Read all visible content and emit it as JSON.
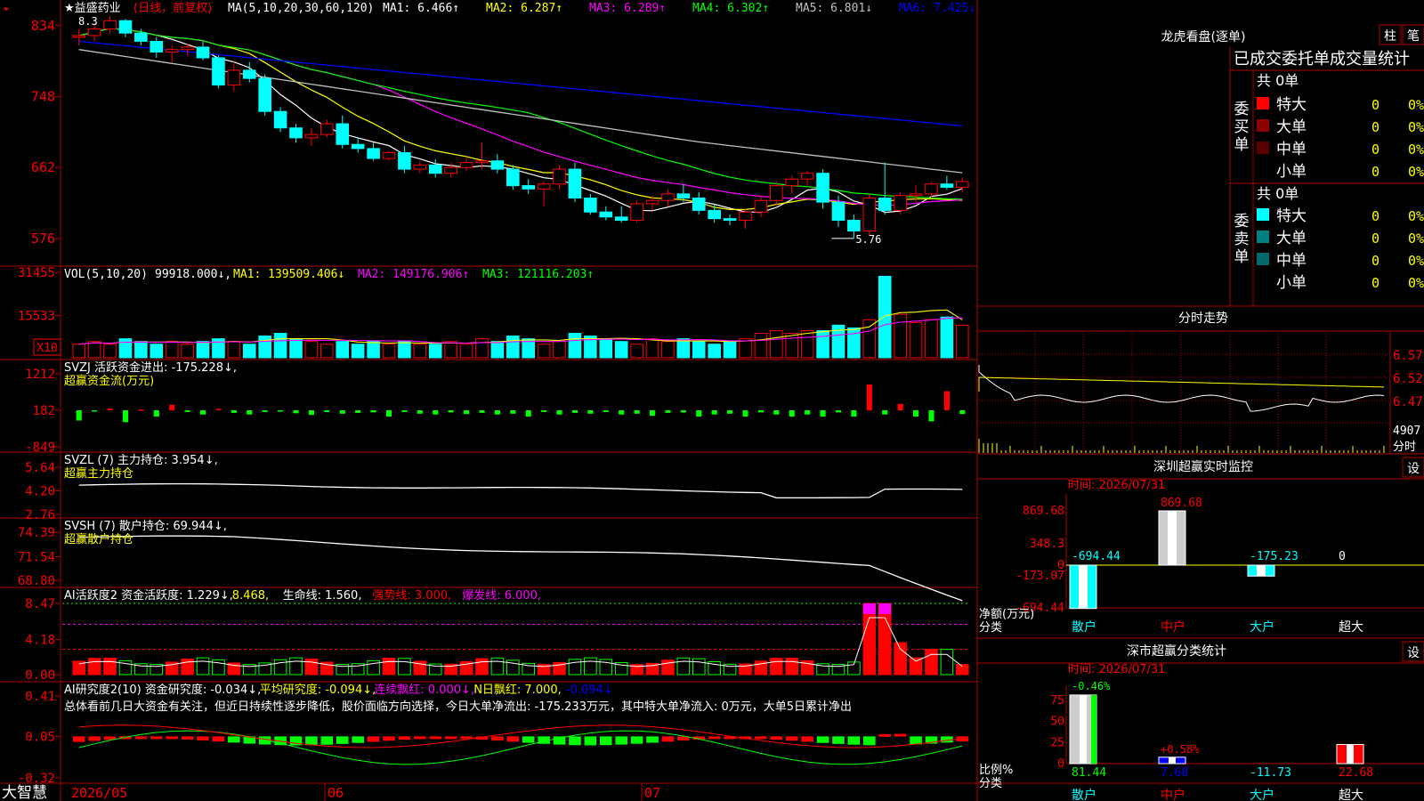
{
  "app": {
    "brand": "大智慧",
    "stock_title": "★益盛药业",
    "period": "(日线，前复权)",
    "ma_prefix": "MA(5,10,20,30,60,120)",
    "ma_values": [
      {
        "label": "MA1: 6.466↑",
        "color": "#ffffff"
      },
      {
        "label": "MA2: 6.287↑",
        "color": "#ffff00"
      },
      {
        "label": "MA3: 6.289↑",
        "color": "#ff00ff"
      },
      {
        "label": "MA4: 6.302↑",
        "color": "#00ff00"
      },
      {
        "label": "MA5: 6.801↓",
        "color": "#c0c0c0"
      },
      {
        "label": "MA6: 7.425↓",
        "color": "#0000ff"
      }
    ],
    "annot_low": "5.76",
    "annot_high": "8.3"
  },
  "colors": {
    "up": "#ff0000",
    "down": "#00ffff",
    "grid": "#b00000",
    "bg": "#000000"
  },
  "axes": {
    "price_ticks": [
      "834",
      "748",
      "662",
      "576"
    ],
    "vol_ticks": [
      "31455",
      "15533"
    ],
    "vol_unit": "X10",
    "svzj_ticks": [
      "1212",
      "182",
      "-849"
    ],
    "svzl_ticks": [
      "5.64",
      "4.20",
      "2.76"
    ],
    "svsh_ticks": [
      "74.39",
      "71.54",
      "68.80"
    ],
    "ai_ticks": [
      "8.47",
      "4.18",
      "0.00"
    ],
    "ai2_ticks": [
      "0.41",
      "0.05",
      "-0.32"
    ],
    "dates": [
      "2026/05",
      "06",
      "07"
    ]
  },
  "chart_data": [
    {
      "type": "candlestick",
      "title": "益盛药业 (日线，前复权)",
      "ylim": [
        5.5,
        8.5
      ],
      "ohlc": [
        [
          8.2,
          8.3,
          8.1,
          8.22
        ],
        [
          8.22,
          8.35,
          8.15,
          8.3
        ],
        [
          8.3,
          8.45,
          8.25,
          8.4
        ],
        [
          8.4,
          8.42,
          8.2,
          8.25
        ],
        [
          8.25,
          8.3,
          8.1,
          8.15
        ],
        [
          8.15,
          8.2,
          7.95,
          8.02
        ],
        [
          8.02,
          8.1,
          7.9,
          8.05
        ],
        [
          8.05,
          8.12,
          7.98,
          8.08
        ],
        [
          8.08,
          8.15,
          7.92,
          7.95
        ],
        [
          7.95,
          7.98,
          7.58,
          7.62
        ],
        [
          7.62,
          7.9,
          7.55,
          7.8
        ],
        [
          7.8,
          7.9,
          7.65,
          7.7
        ],
        [
          7.7,
          7.75,
          7.25,
          7.3
        ],
        [
          7.3,
          7.35,
          7.05,
          7.1
        ],
        [
          7.1,
          7.15,
          6.92,
          6.98
        ],
        [
          6.98,
          7.1,
          6.88,
          7.02
        ],
        [
          7.02,
          7.2,
          6.98,
          7.15
        ],
        [
          7.15,
          7.25,
          6.85,
          6.9
        ],
        [
          6.9,
          6.98,
          6.8,
          6.85
        ],
        [
          6.85,
          6.92,
          6.7,
          6.73
        ],
        [
          6.73,
          6.82,
          6.7,
          6.8
        ],
        [
          6.8,
          6.88,
          6.55,
          6.6
        ],
        [
          6.6,
          6.7,
          6.55,
          6.65
        ],
        [
          6.65,
          6.72,
          6.5,
          6.55
        ],
        [
          6.55,
          6.68,
          6.5,
          6.62
        ],
        [
          6.62,
          6.75,
          6.58,
          6.68
        ],
        [
          6.68,
          6.92,
          6.6,
          6.7
        ],
        [
          6.7,
          6.78,
          6.55,
          6.6
        ],
        [
          6.6,
          6.65,
          6.35,
          6.4
        ],
        [
          6.4,
          6.48,
          6.3,
          6.36
        ],
        [
          6.36,
          6.45,
          6.15,
          6.42
        ],
        [
          6.42,
          6.65,
          6.35,
          6.6
        ],
        [
          6.6,
          6.68,
          6.2,
          6.25
        ],
        [
          6.25,
          6.3,
          6.05,
          6.08
        ],
        [
          6.08,
          6.15,
          5.98,
          6.02
        ],
        [
          6.02,
          6.15,
          5.95,
          5.98
        ],
        [
          5.98,
          6.22,
          5.95,
          6.18
        ],
        [
          6.18,
          6.28,
          6.1,
          6.22
        ],
        [
          6.22,
          6.35,
          6.15,
          6.3
        ],
        [
          6.3,
          6.42,
          6.2,
          6.25
        ],
        [
          6.25,
          6.32,
          6.05,
          6.1
        ],
        [
          6.1,
          6.18,
          5.95,
          6.0
        ],
        [
          6.0,
          6.05,
          5.92,
          5.98
        ],
        [
          5.98,
          6.12,
          5.88,
          6.08
        ],
        [
          6.08,
          6.28,
          6.02,
          6.22
        ],
        [
          6.22,
          6.45,
          6.15,
          6.4
        ],
        [
          6.4,
          6.52,
          6.3,
          6.48
        ],
        [
          6.48,
          6.58,
          6.4,
          6.55
        ],
        [
          6.55,
          6.6,
          6.12,
          6.2
        ],
        [
          6.2,
          6.28,
          5.9,
          5.98
        ],
        [
          5.98,
          6.05,
          5.76,
          5.85
        ],
        [
          5.85,
          6.3,
          5.8,
          6.25
        ],
        [
          6.25,
          6.68,
          6.05,
          6.1
        ],
        [
          6.1,
          6.32,
          6.05,
          6.28
        ],
        [
          6.28,
          6.4,
          6.2,
          6.3
        ],
        [
          6.3,
          6.45,
          6.25,
          6.42
        ],
        [
          6.42,
          6.52,
          6.35,
          6.38
        ],
        [
          6.38,
          6.5,
          6.32,
          6.45
        ]
      ]
    },
    {
      "type": "bar",
      "name": "VOL(5,10,20)",
      "summary": "99918.000",
      "ma": [
        "MA1: 139509.406↓",
        "MA2: 149176.906↑",
        "MA3: 121116.203↑"
      ]
    },
    {
      "type": "bar",
      "name": "SVZJ 活跃资金进出",
      "value_text": "SVZJ  活跃资金进出: -175.228↓,",
      "sub": "超赢资金流(万元)"
    },
    {
      "type": "line",
      "name": "SVZL (7) 主力持仓",
      "value_text": "SVZL (7) 主力持仓: 3.954↓,",
      "sub": "超赢主力持仓"
    },
    {
      "type": "line",
      "name": "SVSH (7) 散户持仓",
      "value_text": "SVSH (7) 散户持仓: 69.944↓,",
      "sub": "超赢散户持仓"
    },
    {
      "type": "bar",
      "name": "AI活跃度2",
      "value_parts": [
        {
          "t": "AI活跃度2 资金活跃度: 1.229↓,",
          "c": "#ffffff"
        },
        {
          "t": "8.468,",
          "c": "#ffff00"
        },
        {
          "t": "生命线: 1.560,",
          "c": "#ffffff"
        },
        {
          "t": "强势线: 3.000,",
          "c": "#ff0000"
        },
        {
          "t": "爆发线: 6.000,",
          "c": "#ff00ff"
        }
      ]
    },
    {
      "type": "bar",
      "name": "AI研究度2(10)",
      "value_parts": [
        {
          "t": "AI研究度2(10) 资金研究度: -0.034↓,",
          "c": "#ffffff"
        },
        {
          "t": "平均研究度: -0.094↓,",
          "c": "#ffff00"
        },
        {
          "t": "连续飘红: 0.000↓,",
          "c": "#ff00ff"
        },
        {
          "t": "N日飘红: 7.000,",
          "c": "#ffff00"
        },
        {
          "t": "-0.094↓",
          "c": "#0000ff"
        }
      ],
      "comment": "总体看前几日大资金有关注，但近日持续性逐步降低，股价面临方向选择，今日大单净流出: -175.233万元，其中特大单净流入: 0万元，大单5日累计净出"
    },
    {
      "type": "bar",
      "name": "深圳超赢实时监控",
      "categories": [
        "散户",
        "中户",
        "大户",
        "超大"
      ],
      "values": [
        -694.44,
        869.68,
        -175.23,
        0
      ]
    },
    {
      "type": "bar",
      "name": "深市超赢分类统计",
      "categories": [
        "散户",
        "中户",
        "大户",
        "超大"
      ],
      "values": [
        81.44,
        7.6,
        -11.73,
        22.68
      ]
    }
  ],
  "right_panel": {
    "longhu": {
      "title": "龙虎看盘(逐单)",
      "btn_bar": "柱",
      "btn_pen": "笔",
      "tabs_text": "已成交委托单成交量统计",
      "buy_label": "委买单",
      "sell_label": "委卖单",
      "buy_total": "共 0单",
      "sell_total": "共 0单",
      "buy_rows": [
        {
          "name": "特大",
          "count": "0",
          "pct": "0%",
          "color": "#ff0000"
        },
        {
          "name": "大单",
          "count": "0",
          "pct": "0%",
          "color": "#8b0000"
        },
        {
          "name": "中单",
          "count": "0",
          "pct": "0%",
          "color": "#5a0000"
        },
        {
          "name": "小单",
          "count": "0",
          "pct": "0%",
          "color": "#000000"
        }
      ],
      "sell_rows": [
        {
          "name": "特大",
          "count": "0",
          "pct": "0%",
          "color": "#00ffff"
        },
        {
          "name": "大单",
          "count": "0",
          "pct": "0%",
          "color": "#008080"
        },
        {
          "name": "中单",
          "count": "0",
          "pct": "0%",
          "color": "#006a6a"
        },
        {
          "name": "小单",
          "count": "0",
          "pct": "0%",
          "color": "#000000"
        }
      ]
    },
    "intraday": {
      "title": "分时走势",
      "price_labels": [
        "6.57",
        "6.52",
        "6.47"
      ],
      "vol_label": "4907",
      "vol_unit": "分时"
    },
    "monitor": {
      "title": "深圳超赢实时监控",
      "set_btn": "设",
      "time_label": "时间: 2026/07/31",
      "yticks": [
        "869.68",
        "348.3",
        "0",
        "-173.07",
        "-694.44"
      ],
      "unit_label": "净额(万元)",
      "cat_label": "分类",
      "value_labels": [
        "-694.44",
        "869.68",
        "-175.23",
        "0"
      ],
      "categories": [
        "散户",
        "中户",
        "大户",
        "超大"
      ]
    },
    "classify": {
      "title": "深市超赢分类统计",
      "set_btn": "设",
      "time_label": "时间: 2026/07/31",
      "yticks": [
        "75",
        "50",
        "25",
        "0"
      ],
      "top_labels": [
        "-0.46%",
        "+0.58%"
      ],
      "unit_label": "比例%",
      "cat_label": "分类",
      "value_labels": [
        "81.44",
        "7.60",
        "-11.73",
        "22.68"
      ],
      "categories": [
        "散户",
        "中户",
        "大户",
        "超大"
      ]
    }
  }
}
